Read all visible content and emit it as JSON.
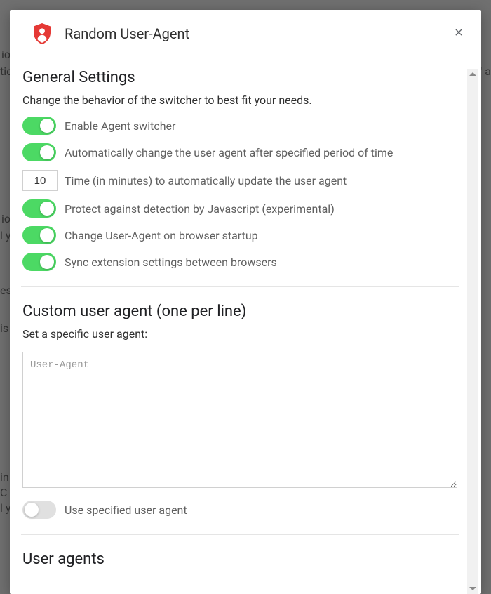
{
  "header": {
    "title": "Random User-Agent"
  },
  "general": {
    "heading": "General Settings",
    "description": "Change the behavior of the switcher to best fit your needs.",
    "enable_switcher": {
      "label": "Enable Agent switcher",
      "on": true
    },
    "auto_change": {
      "label": "Automatically change the user agent after specified period of time",
      "on": true
    },
    "interval": {
      "value": "10",
      "label": "Time (in minutes) to automatically update the user agent"
    },
    "protect_js": {
      "label": "Protect against detection by Javascript (experimental)",
      "on": true
    },
    "change_on_startup": {
      "label": "Change User-Agent on browser startup",
      "on": true
    },
    "sync_settings": {
      "label": "Sync extension settings between browsers",
      "on": true
    }
  },
  "custom_ua": {
    "heading": "Custom user agent (one per line)",
    "label": "Set a specific user agent:",
    "placeholder": "User-Agent",
    "value": "",
    "use_specified": {
      "label": "Use specified user agent",
      "on": false
    }
  },
  "user_agents": {
    "heading": "User agents"
  },
  "bg_snippets": [
    "io",
    "tio",
    "d' a",
    "io",
    "l y",
    "es",
    "is",
    "in",
    "C",
    "l y"
  ]
}
